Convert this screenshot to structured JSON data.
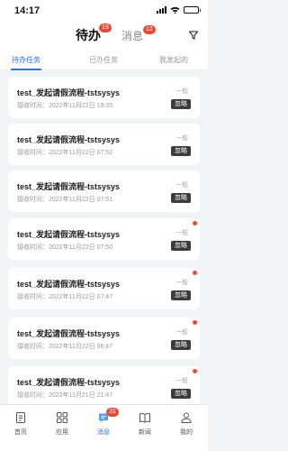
{
  "status_bar": {
    "time": "14:17"
  },
  "header": {
    "tabs": [
      {
        "label": "待办",
        "badge": "19",
        "active": true
      },
      {
        "label": "消息",
        "badge": "12",
        "active": false
      }
    ]
  },
  "sub_tabs": [
    {
      "label": "待办任务",
      "active": true
    },
    {
      "label": "已办任务",
      "active": false
    },
    {
      "label": "我发起的",
      "active": false
    }
  ],
  "tasks": [
    {
      "title": "test_发起请假流程-tstsysys",
      "time": "接收时间：2022年11月22日 19:35",
      "level": "一般",
      "action": "忽略",
      "unread": false
    },
    {
      "title": "test_发起请假流程-tstsysys",
      "time": "接收时间：2022年11月22日 07:52",
      "level": "一般",
      "action": "忽略",
      "unread": false
    },
    {
      "title": "test_发起请假流程-tstsysys",
      "time": "接收时间：2022年11月22日 07:51",
      "level": "一般",
      "action": "忽略",
      "unread": false
    },
    {
      "title": "test_发起请假流程-tstsysys",
      "time": "接收时间：2022年11月22日 07:50",
      "level": "一般",
      "action": "忽略",
      "unread": true
    },
    {
      "title": "test_发起请假流程-tstsysys",
      "time": "接收时间：2022年11月22日 07:47",
      "level": "一般",
      "action": "忽略",
      "unread": true
    },
    {
      "title": "test_发起请假流程-tstsysys",
      "time": "接收时间：2022年11月22日 06:47",
      "level": "一般",
      "action": "忽略",
      "unread": true
    },
    {
      "title": "test_发起请假流程-tstsysys",
      "time": "接收时间：2022年11月21日 21:47",
      "level": "一般",
      "action": "忽略",
      "unread": true
    }
  ],
  "tabbar": [
    {
      "label": "首页",
      "icon": "home-icon"
    },
    {
      "label": "应用",
      "icon": "apps-grid-icon"
    },
    {
      "label": "消息",
      "icon": "chat-icon",
      "badge": "31",
      "active": true
    },
    {
      "label": "新闻",
      "icon": "book-icon"
    },
    {
      "label": "我的",
      "icon": "user-icon"
    }
  ],
  "colors": {
    "accent": "#2f6fd6",
    "badge": "#e84b3c",
    "ignore_button": "#3b3b3b"
  }
}
